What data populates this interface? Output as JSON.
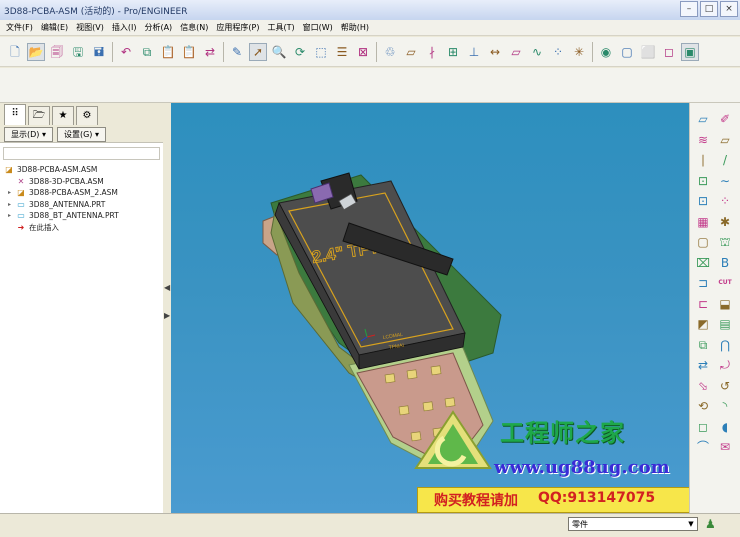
{
  "window": {
    "title": "3D88-PCBA-ASM (活动的) - Pro/ENGINEER",
    "controls": [
      "–",
      "□",
      "×"
    ]
  },
  "menubar": [
    "文件(F)",
    "编辑(E)",
    "视图(V)",
    "插入(I)",
    "分析(A)",
    "信息(N)",
    "应用程序(P)",
    "工具(T)",
    "窗口(W)",
    "帮助(H)"
  ],
  "toolbar": [
    {
      "icon": "new-file-icon",
      "glyph": "🗋"
    },
    {
      "icon": "open-folder-icon",
      "glyph": "📂",
      "active": true
    },
    {
      "icon": "open-component-icon",
      "glyph": "🗐"
    },
    {
      "icon": "save-icon",
      "glyph": "🖫"
    },
    {
      "icon": "save-copy-icon",
      "glyph": "🖬"
    },
    {
      "sep": true
    },
    {
      "icon": "undo-icon",
      "glyph": "↶"
    },
    {
      "icon": "copy-icon",
      "glyph": "⧉"
    },
    {
      "icon": "paste-icon",
      "glyph": "📋"
    },
    {
      "icon": "paste-special-icon",
      "glyph": "📋"
    },
    {
      "icon": "regenerate-icon",
      "glyph": "⇄"
    },
    {
      "sep": true
    },
    {
      "icon": "edit-definition-icon",
      "glyph": "✎"
    },
    {
      "icon": "select-icon",
      "glyph": "➚",
      "active": true
    },
    {
      "icon": "zoom-icon",
      "glyph": "🔍"
    },
    {
      "icon": "spin-icon",
      "glyph": "⟳"
    },
    {
      "icon": "orient-icon",
      "glyph": "⬚"
    },
    {
      "icon": "layers-icon",
      "glyph": "☰"
    },
    {
      "icon": "close-window-icon",
      "glyph": "⊠"
    },
    {
      "sep": true
    },
    {
      "icon": "repaint-icon",
      "glyph": "♲"
    },
    {
      "icon": "datum-plane-icon",
      "glyph": "⏥"
    },
    {
      "icon": "datum-axis-icon",
      "glyph": "∤"
    },
    {
      "icon": "datum-point-icon",
      "glyph": "⊞"
    },
    {
      "icon": "csys-icon",
      "glyph": "⊥"
    },
    {
      "icon": "dimension-icon",
      "glyph": "↔"
    },
    {
      "icon": "surface-icon",
      "glyph": "▱"
    },
    {
      "icon": "curve-icon",
      "glyph": "∿"
    },
    {
      "icon": "point-icon",
      "glyph": "⁘"
    },
    {
      "icon": "spin-center-icon",
      "glyph": "✳"
    },
    {
      "sep": true
    },
    {
      "icon": "appearance-icon",
      "glyph": "◉"
    },
    {
      "icon": "wireframe-icon",
      "glyph": "▢"
    },
    {
      "icon": "hidden-line-icon",
      "glyph": "⬜"
    },
    {
      "icon": "no-hidden-icon",
      "glyph": "◻"
    },
    {
      "icon": "shading-icon",
      "glyph": "▣",
      "active": true
    }
  ],
  "left_panel": {
    "tabs": [
      {
        "icon": "model-tree-icon",
        "glyph": "⠿",
        "active": true
      },
      {
        "icon": "folder-browser-icon",
        "glyph": "🗁"
      },
      {
        "icon": "favorites-icon",
        "glyph": "★"
      },
      {
        "icon": "connections-icon",
        "glyph": "⚙"
      }
    ],
    "show_button": "显示(D) ▾",
    "settings_button": "设置(G) ▾",
    "tree": [
      {
        "label": "3D88-PCBA-ASM.ASM",
        "icon": "assembly-icon",
        "glyph": "◪",
        "level": 0,
        "color": "#c98a1b"
      },
      {
        "label": "3D88-3D-PCBA.ASM",
        "icon": "csys-icon",
        "glyph": "✕",
        "level": 1,
        "color": "#b0488b"
      },
      {
        "label": "3D88-PCBA-ASM_2.ASM",
        "icon": "assembly-icon",
        "glyph": "◪",
        "level": 1,
        "color": "#c98a1b",
        "expand": true
      },
      {
        "label": "3D88_ANTENNA.PRT",
        "icon": "part-icon",
        "glyph": "▭",
        "level": 1,
        "color": "#2b9bc9",
        "expand": true
      },
      {
        "label": "3D88_BT_ANTENNA.PRT",
        "icon": "part-icon",
        "glyph": "▭",
        "level": 1,
        "color": "#2b9bc9",
        "expand": true
      },
      {
        "label": "在此插入",
        "icon": "insert-here-icon",
        "glyph": "➜",
        "level": 1,
        "color": "#d02020"
      }
    ]
  },
  "right_toolbar": [
    {
      "icon": "datum-plane-r-icon",
      "glyph": "⏥"
    },
    {
      "icon": "sketch-r-icon",
      "glyph": "✐"
    },
    {
      "icon": "pattern-r-icon",
      "glyph": "≋"
    },
    {
      "icon": "plane-r-icon",
      "glyph": "▱"
    },
    {
      "icon": "axis-r-icon",
      "glyph": "∣"
    },
    {
      "icon": "line-r-icon",
      "glyph": "/"
    },
    {
      "icon": "offset-r-icon",
      "glyph": "⊡"
    },
    {
      "icon": "curve-r-icon",
      "glyph": "∼"
    },
    {
      "icon": "point-r-icon",
      "glyph": "⊡"
    },
    {
      "icon": "points-r-icon",
      "glyph": "⁘"
    },
    {
      "icon": "grid-r-icon",
      "glyph": "▦"
    },
    {
      "icon": "analysis-r-icon",
      "glyph": "✱"
    },
    {
      "icon": "extrude-r-icon",
      "glyph": "▢"
    },
    {
      "icon": "revolve-r-icon",
      "glyph": "⛫"
    },
    {
      "icon": "hole-r-icon",
      "glyph": "⌧"
    },
    {
      "icon": "form-r-icon",
      "glyph": "B"
    },
    {
      "icon": "shell-r-icon",
      "glyph": "⊐"
    },
    {
      "icon": "cut-r-icon",
      "glyph": "CUT"
    },
    {
      "icon": "rib-r-icon",
      "glyph": "⊏"
    },
    {
      "icon": "round-r-icon",
      "glyph": "⬓"
    },
    {
      "icon": "chamfer-r-icon",
      "glyph": "◩"
    },
    {
      "icon": "draft-r-icon",
      "glyph": "▤"
    },
    {
      "icon": "mirror-r-icon",
      "glyph": "⧉"
    },
    {
      "icon": "bend-r-icon",
      "glyph": "⋂"
    },
    {
      "icon": "flip-r-icon",
      "glyph": "⇄"
    },
    {
      "icon": "unbend-r-icon",
      "glyph": "⤾"
    },
    {
      "icon": "flange-r-icon",
      "glyph": "⬂"
    },
    {
      "icon": "corner-r-icon",
      "glyph": "↺"
    },
    {
      "icon": "twist-r-icon",
      "glyph": "⟲"
    },
    {
      "icon": "rip-r-icon",
      "glyph": "◝"
    },
    {
      "icon": "form2-r-icon",
      "glyph": "◻"
    },
    {
      "icon": "punch-r-icon",
      "glyph": "◖"
    },
    {
      "icon": "notch-r-icon",
      "glyph": "⌒"
    },
    {
      "icon": "stamp-r-icon",
      "glyph": "✉"
    }
  ],
  "viewport": {
    "display_text": "2.4\" TFT",
    "label_1": "LCDMAL",
    "label_2": "TPMAI"
  },
  "watermark": {
    "site_cn": "工程师之家",
    "site_url": "www.ug88ug.com",
    "promo": "购买教程请加",
    "qq": "QQ:913147075"
  },
  "status": {
    "filter_value": "零件"
  },
  "colors": {
    "accent_orange": "#c98a1b",
    "viewport_blue": "#3a93c2",
    "watermark_green": "#1ea84a",
    "watermark_blue": "#3a2bd6",
    "promo_bg": "#f7e64a",
    "promo_red": "#d22121"
  }
}
